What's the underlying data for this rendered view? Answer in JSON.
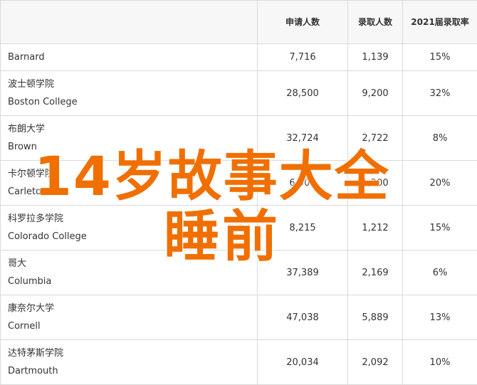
{
  "table": {
    "headers": {
      "name": "",
      "applicants": "申请人数",
      "admitted": "录取人数",
      "rate": "2021届录取率"
    },
    "rows": [
      {
        "cn": "",
        "en": "Barnard",
        "applicants": "7,716",
        "admitted": "1,139",
        "rate": "15%"
      },
      {
        "cn": "波士顿学院",
        "en": "Boston College",
        "applicants": "28,500",
        "admitted": "9,200",
        "rate": "32%"
      },
      {
        "cn": "布朗大学",
        "en": "Brown",
        "applicants": "32,724",
        "admitted": "2,722",
        "rate": "8%"
      },
      {
        "cn": "卡尔顿学院",
        "en": "Carleton",
        "applicants": "6,000",
        "admitted": "1,200",
        "rate": "20%"
      },
      {
        "cn": "科罗拉多学院",
        "en": "Colorado College",
        "applicants": "8,215",
        "admitted": "1,212",
        "rate": "15%"
      },
      {
        "cn": "哥大",
        "en": "Columbia",
        "applicants": "37,389",
        "admitted": "2,169",
        "rate": "6%"
      },
      {
        "cn": "康奈尔大学",
        "en": "Cornell",
        "applicants": "47,038",
        "admitted": "5,889",
        "rate": "13%"
      },
      {
        "cn": "达特茅斯学院",
        "en": "Dartmouth",
        "applicants": "20,034",
        "admitted": "2,092",
        "rate": "10%"
      }
    ]
  },
  "watermark": {
    "line1": "14岁故事大全",
    "line2": "睡前"
  }
}
